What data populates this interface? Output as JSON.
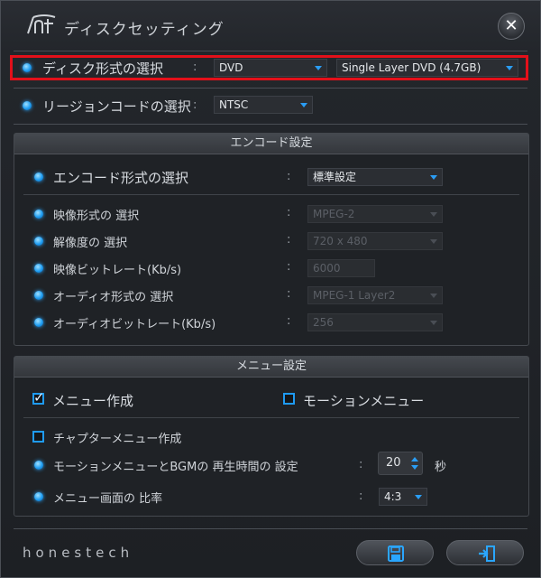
{
  "window": {
    "title": "ディスクセッティング",
    "close_glyph": "✕",
    "brand": "honestech"
  },
  "disc": {
    "format_label": "ディスク形式の選択",
    "format_value": "DVD",
    "type_value": "Single Layer DVD (4.7GB)",
    "region_label": "リージョンコードの選択",
    "region_value": "NTSC"
  },
  "encode": {
    "header": "エンコード設定",
    "format_label": "エンコード形式の選択",
    "format_value": "標準設定",
    "video_format_label": "映像形式の 選択",
    "video_format_value": "MPEG-2",
    "resolution_label": "解像度の 選択",
    "resolution_value": "720 x 480",
    "video_bitrate_label": "映像ビットレート(Kb/s)",
    "video_bitrate_value": "6000",
    "audio_format_label": "オーディオ形式の 選択",
    "audio_format_value": "MPEG-1 Layer2",
    "audio_bitrate_label": "オーディオビットレート(Kb/s)",
    "audio_bitrate_value": "256"
  },
  "menu": {
    "header": "メニュー設定",
    "create_menu_label": "メニュー作成",
    "create_menu_checked": true,
    "motion_menu_label": "モーションメニュー",
    "motion_menu_checked": false,
    "chapter_menu_label": "チャプターメニュー作成",
    "chapter_menu_checked": false,
    "motion_time_label": "モーションメニューとBGMの 再生時間の 設定",
    "motion_time_value": "20",
    "motion_time_unit": "秒",
    "aspect_label": "メニュー画面の 比率",
    "aspect_value": "4:3"
  },
  "colon": ":",
  "colors": {
    "accent": "#1f9bf3",
    "highlight_box": "#e3101a"
  },
  "icons": {
    "save": "floppy-disk-icon",
    "exit": "exit-door-icon",
    "logo": "ht-logo-icon"
  }
}
